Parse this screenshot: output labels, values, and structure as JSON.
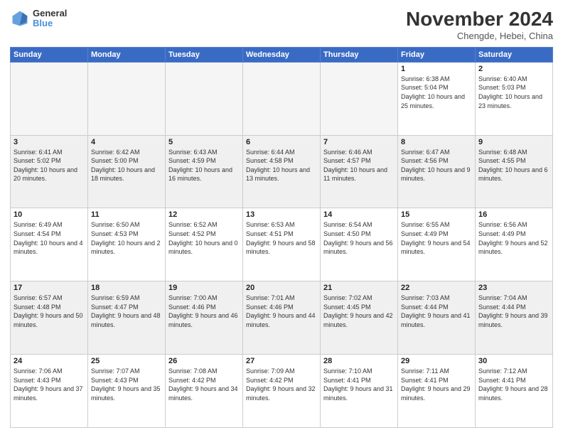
{
  "header": {
    "logo_general": "General",
    "logo_blue": "Blue",
    "month_title": "November 2024",
    "location": "Chengde, Hebei, China"
  },
  "days_header": [
    "Sunday",
    "Monday",
    "Tuesday",
    "Wednesday",
    "Thursday",
    "Friday",
    "Saturday"
  ],
  "weeks": [
    [
      {
        "day": "",
        "info": "",
        "empty": true
      },
      {
        "day": "",
        "info": "",
        "empty": true
      },
      {
        "day": "",
        "info": "",
        "empty": true
      },
      {
        "day": "",
        "info": "",
        "empty": true
      },
      {
        "day": "",
        "info": "",
        "empty": true
      },
      {
        "day": "1",
        "info": "Sunrise: 6:38 AM\nSunset: 5:04 PM\nDaylight: 10 hours and 25 minutes."
      },
      {
        "day": "2",
        "info": "Sunrise: 6:40 AM\nSunset: 5:03 PM\nDaylight: 10 hours and 23 minutes."
      }
    ],
    [
      {
        "day": "3",
        "info": "Sunrise: 6:41 AM\nSunset: 5:02 PM\nDaylight: 10 hours and 20 minutes."
      },
      {
        "day": "4",
        "info": "Sunrise: 6:42 AM\nSunset: 5:00 PM\nDaylight: 10 hours and 18 minutes."
      },
      {
        "day": "5",
        "info": "Sunrise: 6:43 AM\nSunset: 4:59 PM\nDaylight: 10 hours and 16 minutes."
      },
      {
        "day": "6",
        "info": "Sunrise: 6:44 AM\nSunset: 4:58 PM\nDaylight: 10 hours and 13 minutes."
      },
      {
        "day": "7",
        "info": "Sunrise: 6:46 AM\nSunset: 4:57 PM\nDaylight: 10 hours and 11 minutes."
      },
      {
        "day": "8",
        "info": "Sunrise: 6:47 AM\nSunset: 4:56 PM\nDaylight: 10 hours and 9 minutes."
      },
      {
        "day": "9",
        "info": "Sunrise: 6:48 AM\nSunset: 4:55 PM\nDaylight: 10 hours and 6 minutes."
      }
    ],
    [
      {
        "day": "10",
        "info": "Sunrise: 6:49 AM\nSunset: 4:54 PM\nDaylight: 10 hours and 4 minutes."
      },
      {
        "day": "11",
        "info": "Sunrise: 6:50 AM\nSunset: 4:53 PM\nDaylight: 10 hours and 2 minutes."
      },
      {
        "day": "12",
        "info": "Sunrise: 6:52 AM\nSunset: 4:52 PM\nDaylight: 10 hours and 0 minutes."
      },
      {
        "day": "13",
        "info": "Sunrise: 6:53 AM\nSunset: 4:51 PM\nDaylight: 9 hours and 58 minutes."
      },
      {
        "day": "14",
        "info": "Sunrise: 6:54 AM\nSunset: 4:50 PM\nDaylight: 9 hours and 56 minutes."
      },
      {
        "day": "15",
        "info": "Sunrise: 6:55 AM\nSunset: 4:49 PM\nDaylight: 9 hours and 54 minutes."
      },
      {
        "day": "16",
        "info": "Sunrise: 6:56 AM\nSunset: 4:49 PM\nDaylight: 9 hours and 52 minutes."
      }
    ],
    [
      {
        "day": "17",
        "info": "Sunrise: 6:57 AM\nSunset: 4:48 PM\nDaylight: 9 hours and 50 minutes."
      },
      {
        "day": "18",
        "info": "Sunrise: 6:59 AM\nSunset: 4:47 PM\nDaylight: 9 hours and 48 minutes."
      },
      {
        "day": "19",
        "info": "Sunrise: 7:00 AM\nSunset: 4:46 PM\nDaylight: 9 hours and 46 minutes."
      },
      {
        "day": "20",
        "info": "Sunrise: 7:01 AM\nSunset: 4:46 PM\nDaylight: 9 hours and 44 minutes."
      },
      {
        "day": "21",
        "info": "Sunrise: 7:02 AM\nSunset: 4:45 PM\nDaylight: 9 hours and 42 minutes."
      },
      {
        "day": "22",
        "info": "Sunrise: 7:03 AM\nSunset: 4:44 PM\nDaylight: 9 hours and 41 minutes."
      },
      {
        "day": "23",
        "info": "Sunrise: 7:04 AM\nSunset: 4:44 PM\nDaylight: 9 hours and 39 minutes."
      }
    ],
    [
      {
        "day": "24",
        "info": "Sunrise: 7:06 AM\nSunset: 4:43 PM\nDaylight: 9 hours and 37 minutes."
      },
      {
        "day": "25",
        "info": "Sunrise: 7:07 AM\nSunset: 4:43 PM\nDaylight: 9 hours and 35 minutes."
      },
      {
        "day": "26",
        "info": "Sunrise: 7:08 AM\nSunset: 4:42 PM\nDaylight: 9 hours and 34 minutes."
      },
      {
        "day": "27",
        "info": "Sunrise: 7:09 AM\nSunset: 4:42 PM\nDaylight: 9 hours and 32 minutes."
      },
      {
        "day": "28",
        "info": "Sunrise: 7:10 AM\nSunset: 4:41 PM\nDaylight: 9 hours and 31 minutes."
      },
      {
        "day": "29",
        "info": "Sunrise: 7:11 AM\nSunset: 4:41 PM\nDaylight: 9 hours and 29 minutes."
      },
      {
        "day": "30",
        "info": "Sunrise: 7:12 AM\nSunset: 4:41 PM\nDaylight: 9 hours and 28 minutes."
      }
    ]
  ]
}
